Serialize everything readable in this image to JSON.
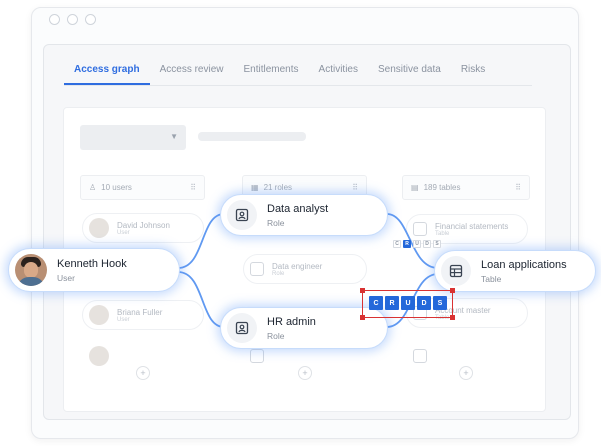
{
  "tabs": [
    {
      "label": "Access graph",
      "active": true
    },
    {
      "label": "Access review",
      "active": false
    },
    {
      "label": "Entitlements",
      "active": false
    },
    {
      "label": "Activities",
      "active": false
    },
    {
      "label": "Sensitive data",
      "active": false
    },
    {
      "label": "Risks",
      "active": false
    }
  ],
  "columns": {
    "users": "10 users",
    "roles": "21 roles",
    "tables": "189 tables"
  },
  "ghost_rows": {
    "user1": {
      "name": "David Johnson",
      "sub": "User"
    },
    "user2": {
      "name": "Briana Fuller",
      "sub": "User"
    },
    "role1": {
      "name": "Data engineer",
      "sub": "Role"
    },
    "table1": {
      "name": "Financial statements",
      "sub": "Table"
    },
    "table2": {
      "name": "Account master",
      "sub": "Table"
    }
  },
  "nodes": {
    "user": {
      "title": "Kenneth Hook",
      "subtitle": "User"
    },
    "role_top": {
      "title": "Data analyst",
      "subtitle": "Role"
    },
    "role_bottom": {
      "title": "HR admin",
      "subtitle": "Role"
    },
    "table": {
      "title": "Loan applications",
      "subtitle": "Table"
    }
  },
  "permissions_large": [
    "C",
    "R",
    "U",
    "D",
    "S"
  ],
  "permissions_small": [
    "C",
    "R",
    "U",
    "D",
    "S"
  ],
  "colors": {
    "accent": "#2f6de0",
    "chip_blue": "#2468da",
    "selection_red": "#d93232",
    "edge_blue": "#4f8ef0"
  },
  "icons": {
    "role": "id-badge-icon",
    "table": "table-grid-icon",
    "users_column": "person-icon",
    "roles_column": "role-card-icon",
    "tables_column": "table-icon"
  }
}
